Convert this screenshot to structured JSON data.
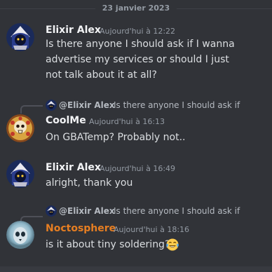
{
  "date_divider": "23 janvier 2023",
  "messages": [
    {
      "author": "Elixir Alex",
      "timestamp": "Aujourd'hui à 12:22",
      "lines": [
        "Is there anyone I should ask if I wanna",
        "advertise my services or should I just",
        "not talk about it at all?"
      ]
    },
    {
      "reply": {
        "author": "@Elixir Alex",
        "text": "Is there anyone I should ask if"
      },
      "author": "CoolMe",
      "timestamp": "Aujourd'hui à 16:13",
      "lines": [
        "On GBATemp? Probably not.."
      ]
    },
    {
      "author": "Elixir Alex",
      "timestamp": "Aujourd'hui à 16:49",
      "lines": [
        "alright, thank you"
      ]
    },
    {
      "reply": {
        "author": "@Elixir Alex",
        "text": "Is there anyone I should ask if"
      },
      "author": "Noctosphere",
      "timestamp": "Aujourd'hui à 18:16",
      "lines": [
        "is it about tiny soldering?"
      ],
      "emoji": "laughing-tears-emoji"
    }
  ],
  "colors": {
    "background": "#313338",
    "username_default": "#f2f3f5",
    "username_noctosphere": "#e67e22",
    "text": "#dbdee1",
    "muted": "#949ba4"
  }
}
